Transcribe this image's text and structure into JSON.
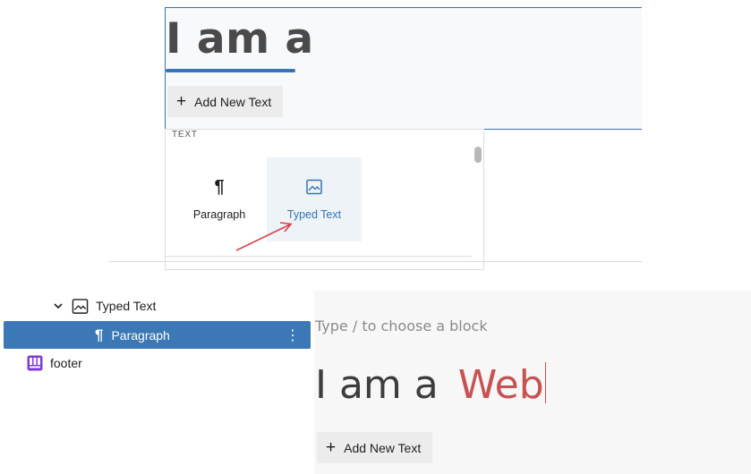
{
  "top_editor": {
    "heading_static": "I am a",
    "add_button_label": "Add New Text",
    "add_button_icon": "+"
  },
  "inserter": {
    "category_label": "TEXT",
    "blocks": [
      {
        "label": "Paragraph",
        "icon": "pilcrow-icon",
        "glyph": "¶"
      },
      {
        "label": "Typed Text",
        "icon": "image-icon"
      }
    ]
  },
  "list_view": {
    "items": [
      {
        "label": "Typed Text",
        "icon": "image-icon",
        "expanded": true
      },
      {
        "label": "Paragraph",
        "icon": "pilcrow-icon",
        "glyph": "¶",
        "selected": true,
        "options_glyph": "⋮"
      },
      {
        "label": "footer",
        "icon": "template-part-icon"
      }
    ]
  },
  "bottom_editor": {
    "placeholder": "Type / to choose a block",
    "heading_static": "I am a",
    "heading_typed": "Web",
    "add_button_label": "Add New Text",
    "add_button_icon": "+"
  },
  "colors": {
    "accent_blue": "#3575b5",
    "selection_blue": "#3b78b5",
    "typed_red": "#c65352",
    "annotation_arrow": "#d9414a",
    "footer_icon_purple": "#7c3bd6"
  }
}
